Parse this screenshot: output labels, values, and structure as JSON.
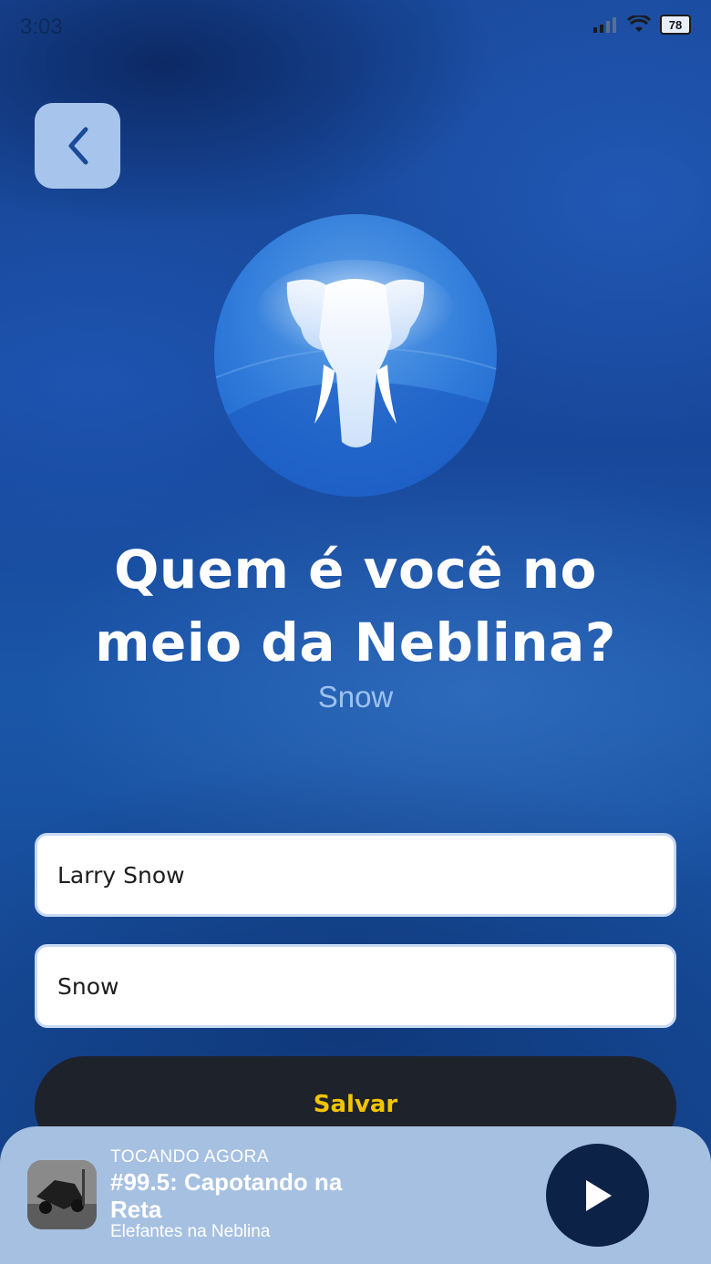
{
  "status_bar": {
    "time": "3:03",
    "battery": "78"
  },
  "profile": {
    "title_line1": "Quem é você no",
    "title_line2": "meio da Neblina?",
    "subtitle": "Snow"
  },
  "form": {
    "name_value": "Larry Snow",
    "nickname_value": "Snow",
    "save_label": "Salvar"
  },
  "now_playing": {
    "label": "TOCANDO AGORA",
    "title": "#99.5:  Capotando na Reta",
    "artist": "Elefantes na Neblina"
  },
  "colors": {
    "accent_yellow": "#f2c500",
    "player_bg": "#a6c0e1",
    "play_button": "#0d2247",
    "back_button": "#a7c5ec"
  },
  "icons": {
    "back": "chevron-left-icon",
    "play": "play-icon",
    "wifi": "wifi-icon",
    "signal": "signal-icon",
    "battery": "battery-icon"
  }
}
